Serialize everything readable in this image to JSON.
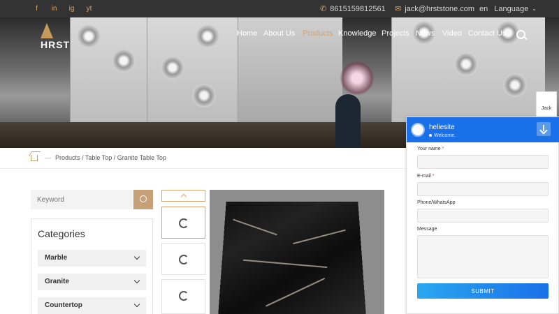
{
  "topbar": {
    "social": [
      "f",
      "in",
      "ig",
      "yt"
    ],
    "phone": "8615159812561",
    "email": "jack@hrststone.com",
    "lang_code": "en",
    "lang_label": "Language"
  },
  "logo": {
    "text": "HRST"
  },
  "nav": {
    "items": [
      "Home",
      "About Us",
      "Products",
      "Knowledge",
      "Projects",
      "News",
      "Video",
      "Contact Us"
    ],
    "active": "Products"
  },
  "breadcrumb": {
    "separator": "—",
    "path": "Products / Table Top / Granite Table Top"
  },
  "sidebar": {
    "search_placeholder": "Keyword",
    "categories_title": "Categories",
    "categories": [
      "Marble",
      "Granite",
      "Countertop"
    ]
  },
  "chat": {
    "agent_tab": "Jack",
    "name": "heliesite",
    "status": "Welcome.",
    "fields": [
      {
        "label": "Your name",
        "required": true
      },
      {
        "label": "E-mail",
        "required": true
      },
      {
        "label": "Phone/WhatsApp",
        "required": false
      },
      {
        "label": "Message",
        "required": false
      }
    ],
    "submit": "SUBMIT"
  },
  "colors": {
    "accent": "#d8a46e",
    "chat_blue": "#1a70e8",
    "topbar": "#333333"
  }
}
